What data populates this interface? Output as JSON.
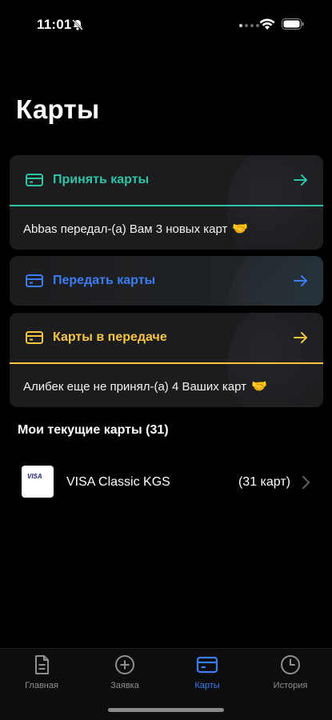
{
  "status": {
    "time": "11:01"
  },
  "title": "Карты",
  "actions": {
    "accept": {
      "label": "Принять карты",
      "color": "#2fc3a6",
      "note": "Abbas передал-(а) Вам 3 новых карт",
      "note_emoji": "🤝"
    },
    "give": {
      "label": "Передать карты",
      "color": "#3b7df5"
    },
    "transfer": {
      "label": "Карты в передаче",
      "color": "#f5c542",
      "note": "Алибек еще не принял-(а) 4 Ваших карт",
      "note_emoji": "🤝"
    }
  },
  "current": {
    "heading": "Мои текущие карты (31)",
    "items": [
      {
        "logo": "VISA",
        "name": "VISA Classic KGS",
        "count": "(31 карт)"
      }
    ]
  },
  "tabs": [
    {
      "label": "Главная",
      "icon": "document-icon"
    },
    {
      "label": "Заявка",
      "icon": "plus-circle-icon"
    },
    {
      "label": "Карты",
      "icon": "card-icon",
      "active": true
    },
    {
      "label": "История",
      "icon": "clock-icon"
    }
  ],
  "colors": {
    "active_tab": "#3b7df5",
    "inactive_tab": "#8e8e93"
  }
}
